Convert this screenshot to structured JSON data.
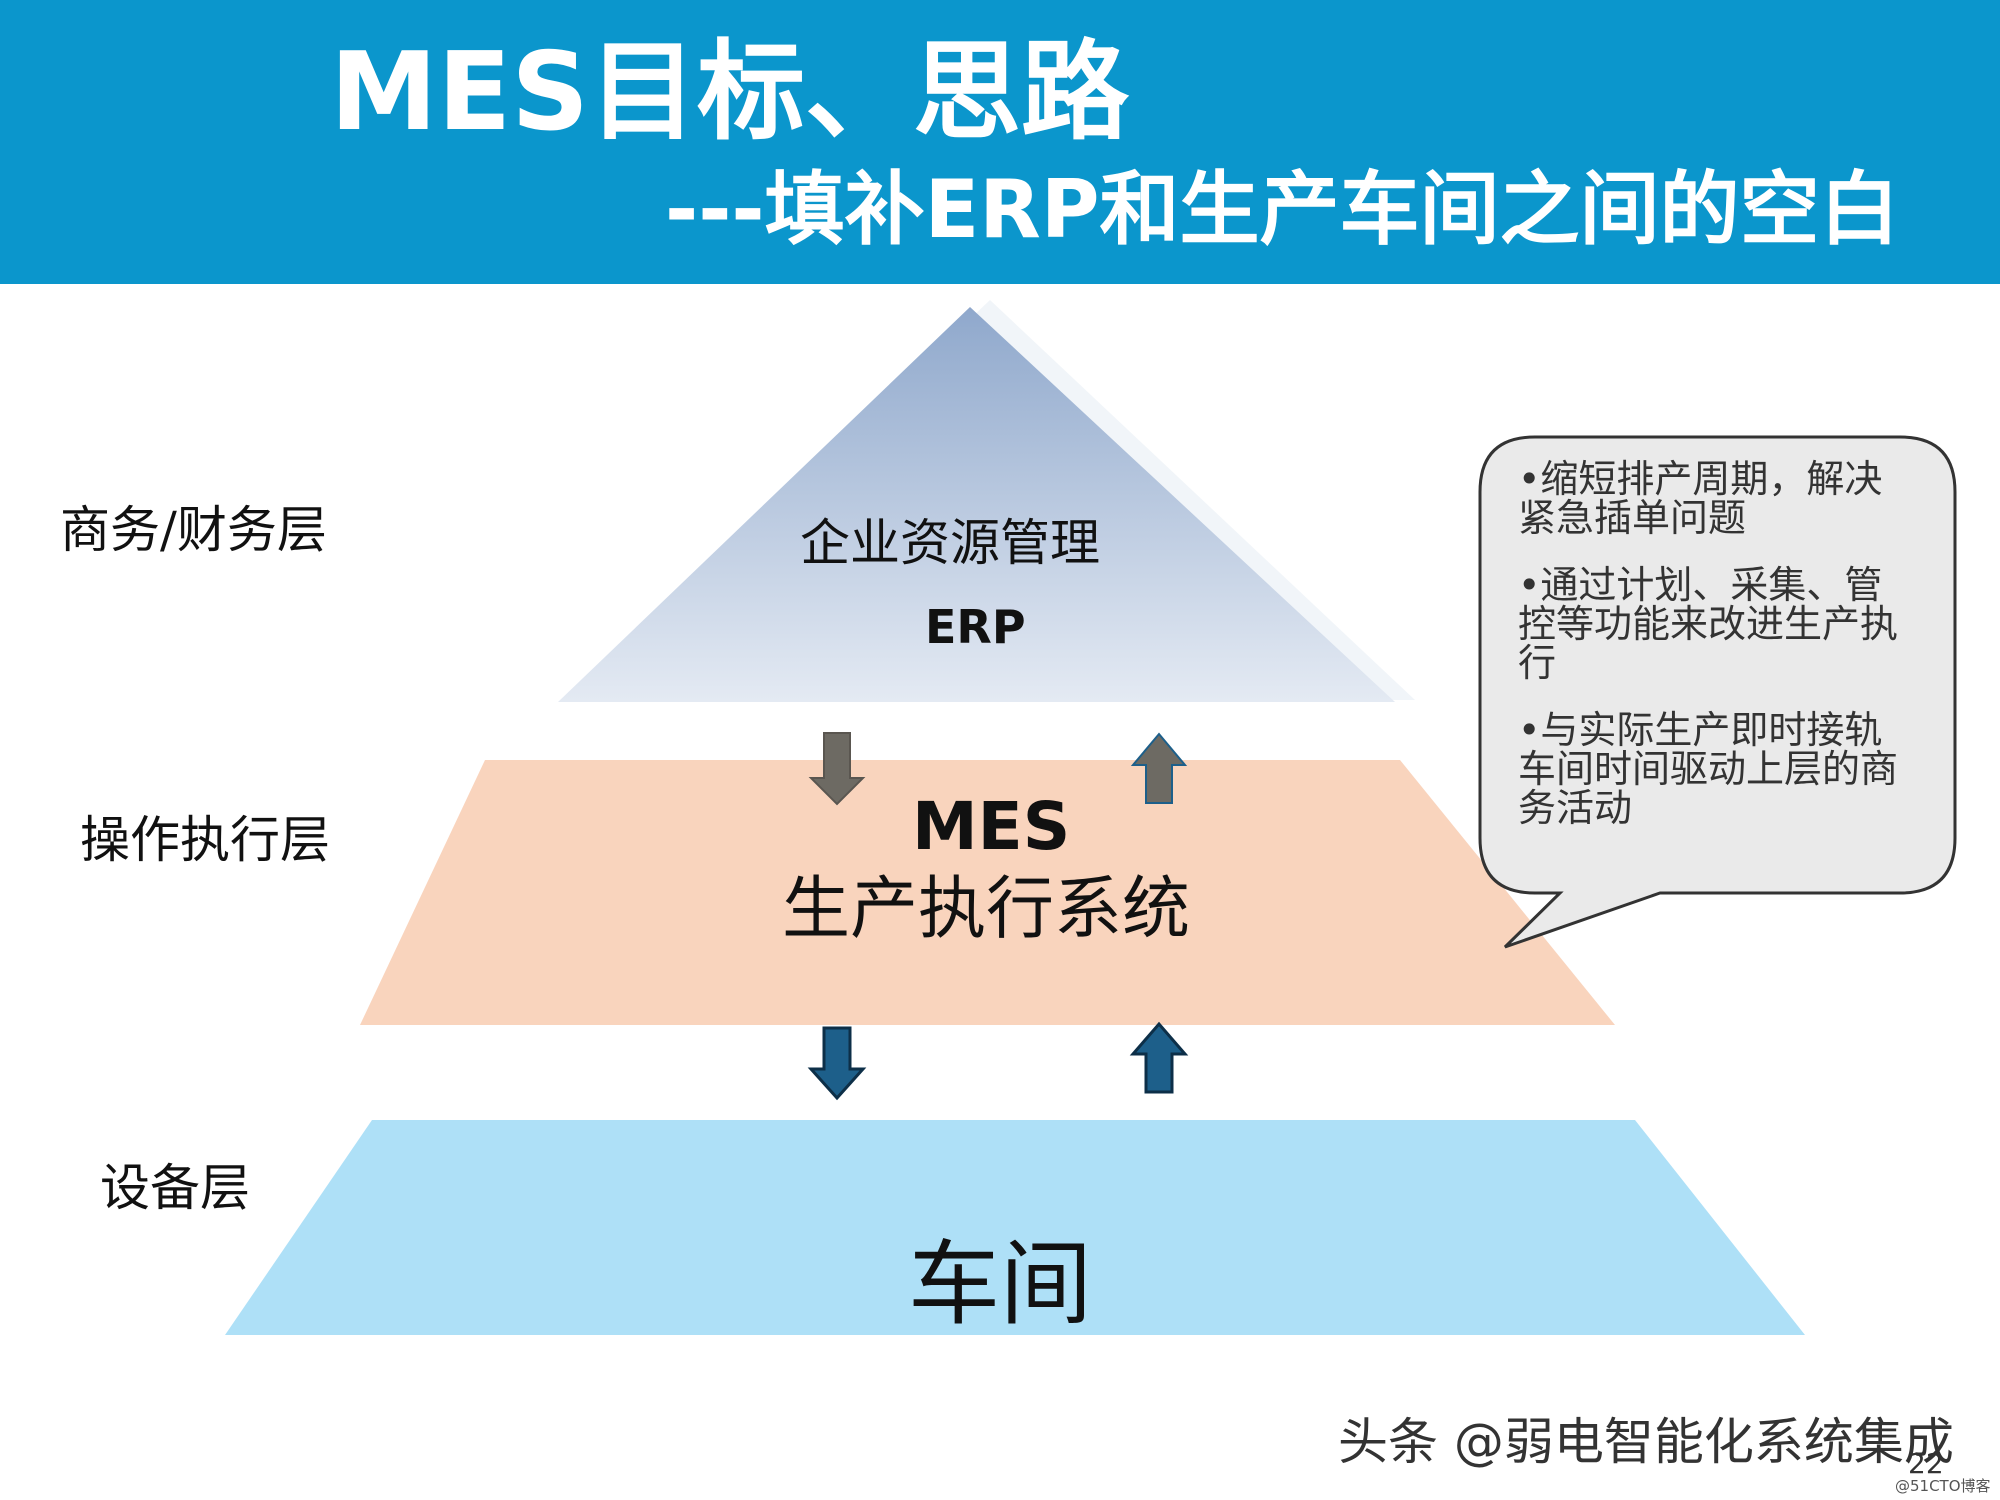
{
  "header": {
    "title": "MES目标、思路",
    "subtitle": "---填补ERP和生产车间之间的空白"
  },
  "layers": {
    "business": "商务/财务层",
    "operation": "操作执行层",
    "equipment": "设备层"
  },
  "erp": {
    "cn": "企业资源管理",
    "en": "ERP"
  },
  "mes": {
    "en": "MES",
    "cn": "生产执行系统"
  },
  "workshop": {
    "cn": "车间"
  },
  "bubble": {
    "points": [
      "•缩短排产周期，解决紧急插单问题",
      "•通过计划、采集、管控等功能来改进生产执行",
      "•与实际生产即时接轨车间时间驱动上层的商务活动"
    ]
  },
  "footer": {
    "watermark": "头条 @弱电智能化系统集成",
    "page_number": "22",
    "site": "@51CTO博客"
  },
  "colors": {
    "header_bg": "#0b96cc",
    "erp_top": "#8fa8cc",
    "erp_bottom": "#e4eaf3",
    "mes_fill": "#f9d4bd",
    "workshop_fill": "#aee0f7",
    "arrow": "#1d5f8a"
  }
}
